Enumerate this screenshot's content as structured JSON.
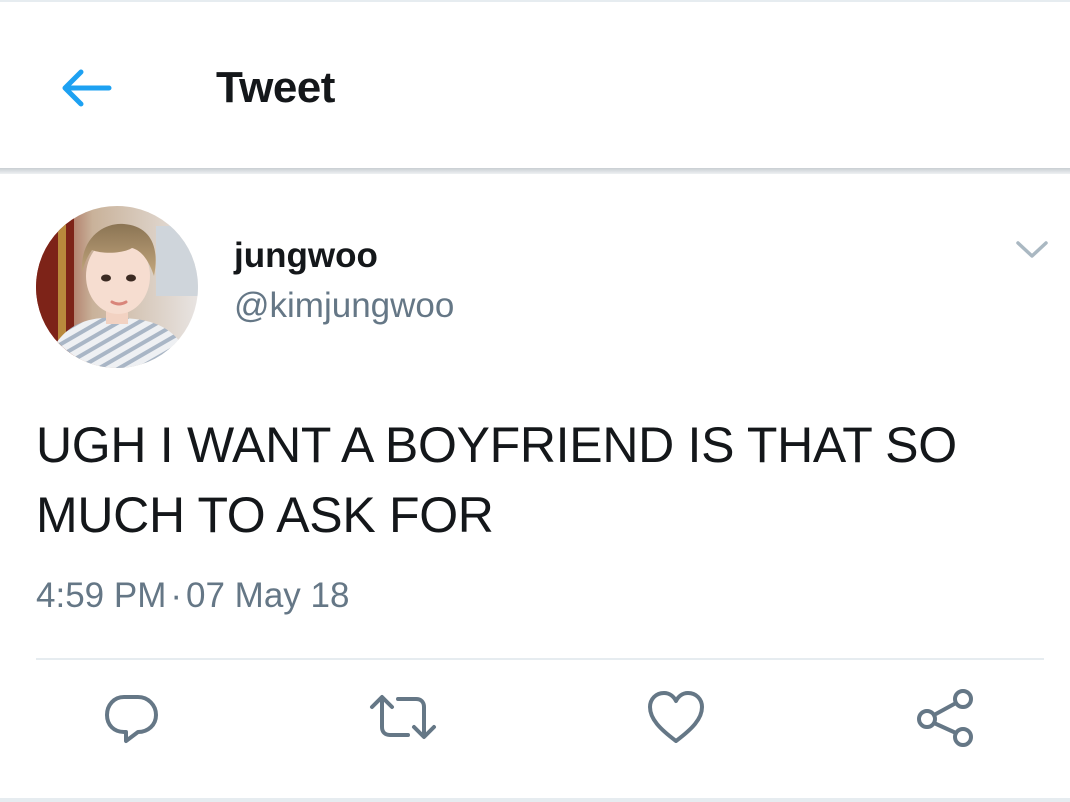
{
  "header": {
    "title": "Tweet",
    "back_icon": "arrow-left-icon",
    "accent_color": "#1da1f2"
  },
  "tweet": {
    "author": {
      "display_name": "jungwoo",
      "handle": "@kimjungwoo",
      "avatar": "profile-photo"
    },
    "text_line1": "UGH I WANT A BOYFRIEND IS THAT SO",
    "text_line2": "MUCH TO ASK FOR",
    "time": "4:59 PM",
    "separator": "·",
    "date": "07 May 18",
    "menu_icon": "chevron-down-icon"
  },
  "actions": [
    {
      "icon": "reply-icon"
    },
    {
      "icon": "retweet-icon"
    },
    {
      "icon": "like-icon"
    },
    {
      "icon": "share-icon"
    }
  ],
  "colors": {
    "text_primary": "#14171a",
    "text_secondary": "#657786",
    "divider": "#e6ecf0",
    "icon_gray": "#657786"
  }
}
